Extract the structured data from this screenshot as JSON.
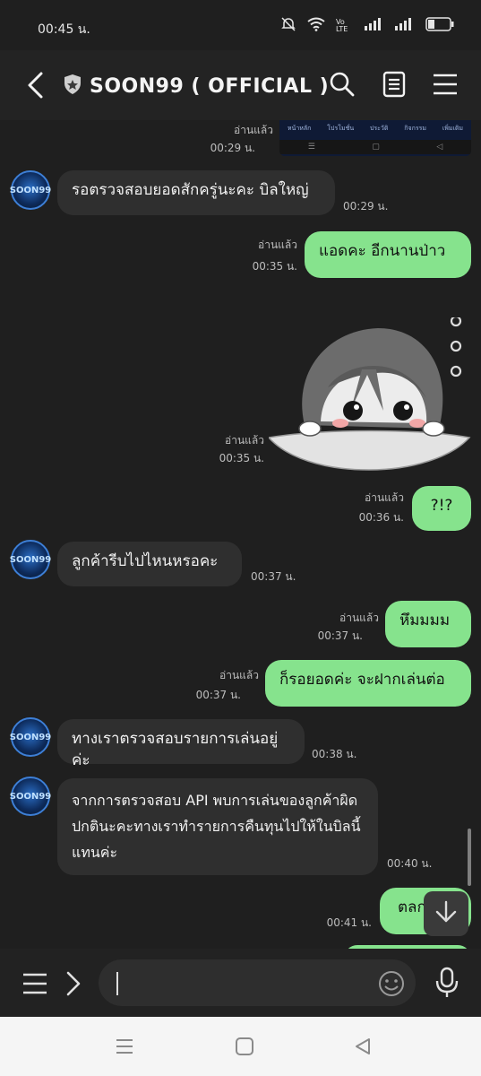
{
  "status": {
    "time": "00:45 น.",
    "net": "Vo LTE"
  },
  "header": {
    "title": "SOON99 ( OFFICIAL )"
  },
  "thumbnail": {
    "menu": [
      "หน้าหลัก",
      "โปรโมชั่น",
      "ประวัติ",
      "กิจกรรม",
      "เพิ่มเติม"
    ],
    "nav": [
      "☰",
      "▢",
      "◁"
    ]
  },
  "messages": {
    "m0": {
      "read": "อ่านแล้ว",
      "time": "00:29 น."
    },
    "m1": {
      "text": "รอตรวจสอบยอดสักครู่นะคะ บิลใหญ่",
      "time": "00:29 น."
    },
    "m2": {
      "text": "แอดคะ อีกนานป่าว",
      "read": "อ่านแล้ว",
      "time": "00:35 น."
    },
    "m3": {
      "read": "อ่านแล้ว",
      "time": "00:35 น."
    },
    "m4": {
      "text": "?!?",
      "read": "อ่านแล้ว",
      "time": "00:36 น."
    },
    "m5": {
      "text": "ลูกค้ารีบไปไหนหรอคะ",
      "time": "00:37 น."
    },
    "m6": {
      "text": "หึมมมม",
      "read": "อ่านแล้ว",
      "time": "00:37 น."
    },
    "m7": {
      "text": "ก็รอยอดค่ะ จะฝากเล่นต่อ",
      "read": "อ่านแล้ว",
      "time": "00:37 น."
    },
    "m8": {
      "text": "ทางเราตรวจสอบรายการเล่นอยู่ค่ะ",
      "time": "00:38 น."
    },
    "m9": {
      "text": "จากการตรวจสอบ API พบการเล่นของลูกค้าผิดปกตินะคะทางเราทำรายการคืนทุนไปให้ในบิลนี้แทนค่ะ",
      "time": "00:40 น."
    },
    "m10": {
      "text": "ตลก",
      "time": "00:41 น."
    }
  },
  "avatar": {
    "label": "SOON99"
  }
}
